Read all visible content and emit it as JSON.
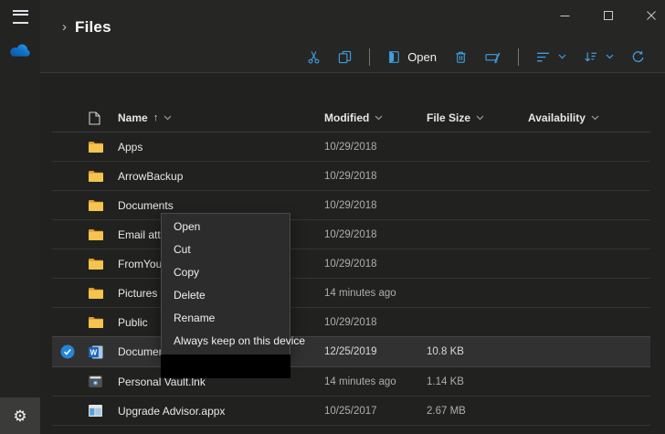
{
  "window": {
    "app": "OneDrive",
    "controls": {
      "minimize": "minimize",
      "maximize": "maximize",
      "close": "close"
    }
  },
  "header": {
    "title": "Files"
  },
  "icons": {
    "breadcrumb_chevron": "›",
    "gear_glyph": "⚙",
    "sort_asc_arrow": "↑",
    "check_glyph": "✓"
  },
  "toolbar": {
    "open_label": "Open"
  },
  "table": {
    "columns": {
      "name": "Name",
      "modified": "Modified",
      "file_size": "File Size",
      "availability": "Availability"
    },
    "rows": [
      {
        "name": "Apps",
        "icon": "folder",
        "modified": "10/29/2018",
        "file_size": "",
        "availability": "",
        "selected": false
      },
      {
        "name": "ArrowBackup",
        "icon": "folder",
        "modified": "10/29/2018",
        "file_size": "",
        "availability": "",
        "selected": false
      },
      {
        "name": "Documents",
        "icon": "folder",
        "modified": "10/29/2018",
        "file_size": "",
        "availability": "",
        "selected": false
      },
      {
        "name": "Email atta",
        "icon": "folder",
        "modified": "10/29/2018",
        "file_size": "",
        "availability": "",
        "selected": false
      },
      {
        "name": "FromYour",
        "icon": "folder",
        "modified": "10/29/2018",
        "file_size": "",
        "availability": "",
        "selected": false
      },
      {
        "name": "Pictures",
        "icon": "folder",
        "modified": "14 minutes ago",
        "file_size": "",
        "availability": "",
        "selected": false
      },
      {
        "name": "Public",
        "icon": "folder",
        "modified": "10/29/2018",
        "file_size": "",
        "availability": "",
        "selected": false
      },
      {
        "name": "Documen",
        "icon": "word",
        "modified": "12/25/2019",
        "file_size": "10.8 KB",
        "availability": "",
        "selected": true
      },
      {
        "name": "Personal Vault.lnk",
        "icon": "vault",
        "modified": "14 minutes ago",
        "file_size": "1.14 KB",
        "availability": "",
        "selected": false
      },
      {
        "name": "Upgrade Advisor.appx",
        "icon": "appx",
        "modified": "10/25/2017",
        "file_size": "2.67 MB",
        "availability": "",
        "selected": false
      }
    ]
  },
  "context_menu": {
    "items": [
      "Open",
      "Cut",
      "Copy",
      "Delete",
      "Rename",
      "Always keep on this device"
    ]
  },
  "colors": {
    "accent_blue": "#3f9fe0",
    "selection_check": "#2684d9",
    "folder_yellow": "#f5c44e",
    "header_bg": "#262625",
    "content_bg": "#212120",
    "menu_bg": "#2c2c2c"
  }
}
